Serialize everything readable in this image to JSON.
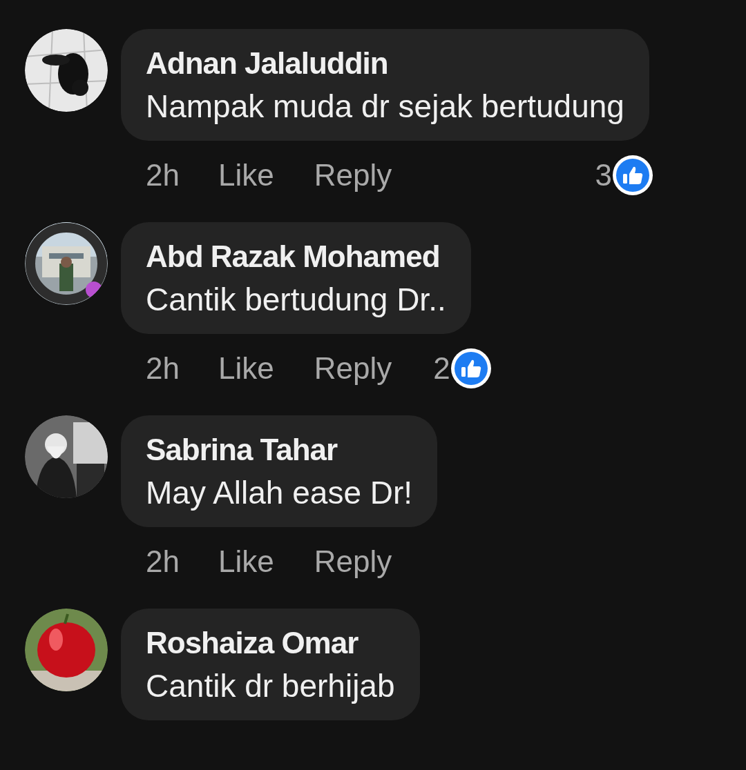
{
  "comments": [
    {
      "author": "Adnan Jalaluddin",
      "text": "Nampak muda dr sejak bertudung",
      "time": "2h",
      "like": "Like",
      "reply": "Reply",
      "reactions": "3"
    },
    {
      "author": "Abd Razak Mohamed",
      "text": "Cantik bertudung Dr..",
      "time": "2h",
      "like": "Like",
      "reply": "Reply",
      "reactions": "2"
    },
    {
      "author": "Sabrina Tahar",
      "text": "May Allah ease Dr!",
      "time": "2h",
      "like": "Like",
      "reply": "Reply"
    },
    {
      "author": "Roshaiza Omar",
      "text": "Cantik dr berhijab"
    }
  ]
}
